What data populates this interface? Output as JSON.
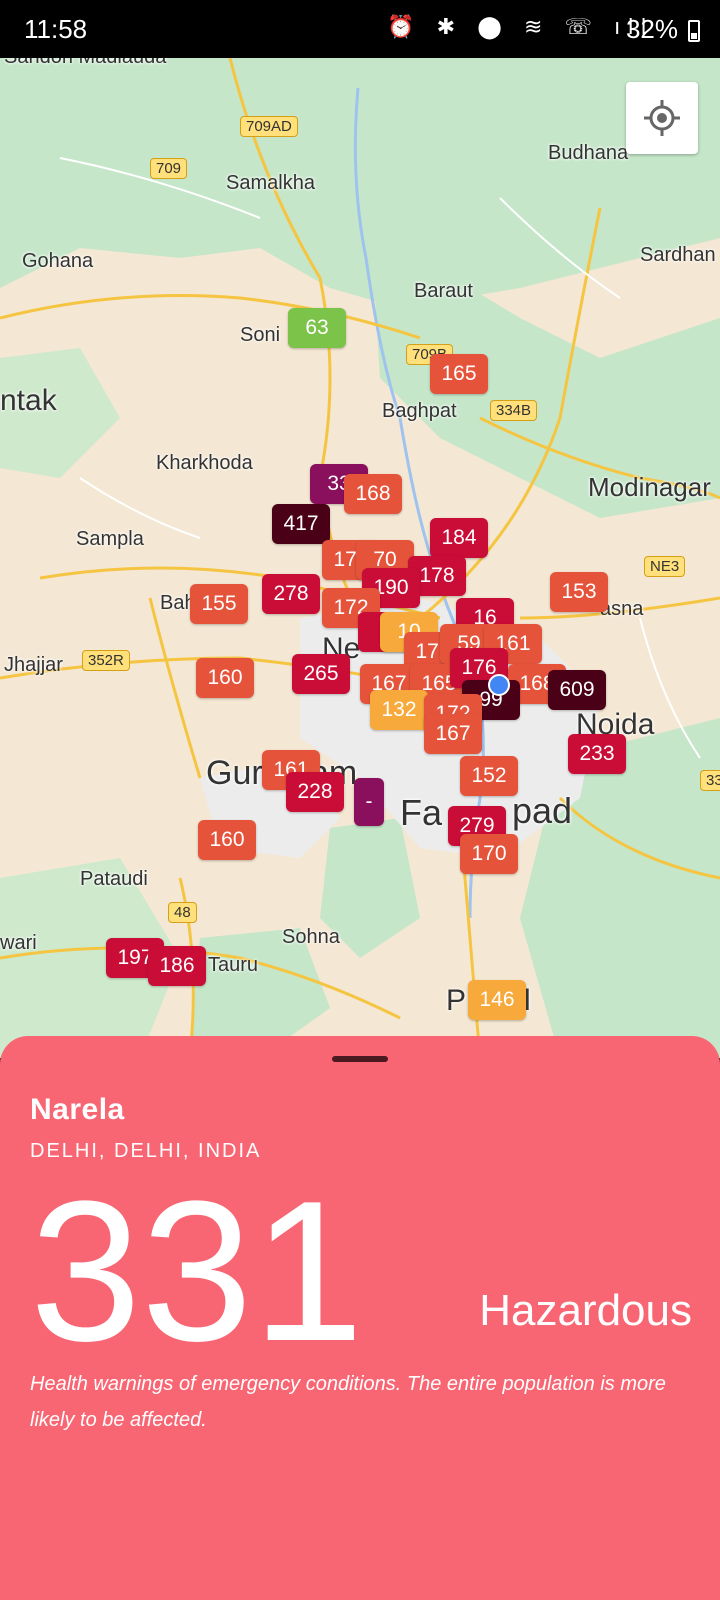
{
  "status_bar": {
    "time": "11:58",
    "icons": "⏰ ✱ ⬤ ≋ ☏ ıll",
    "battery": "32%"
  },
  "map": {
    "place_labels": [
      "Sandoh Madlauda",
      "Samalkha",
      "Budhana",
      "Gohana",
      "Sardhan",
      "Baraut",
      "Soni",
      "Baghpat",
      "ntak",
      "Kharkhoda",
      "Modinagar",
      "Sampla",
      "Bah",
      "g",
      "asna",
      "Jhajjar",
      "Ne",
      "Noida",
      "Gur",
      "am",
      "Fa",
      "pad",
      "Pataudi",
      "Sohna",
      "wari",
      "Tauru",
      "P",
      "l"
    ],
    "road_shields": [
      "709AD",
      "709",
      "709B",
      "334B",
      "352R",
      "NE3",
      "48",
      "33"
    ],
    "markers": [
      {
        "value": "63",
        "color": "#7cc34a"
      },
      {
        "value": "165",
        "color": "#e5533b"
      },
      {
        "value": "33",
        "color": "#8a0f5c"
      },
      {
        "value": "168",
        "color": "#e5533b"
      },
      {
        "value": "417",
        "color": "#4a0017"
      },
      {
        "value": "184",
        "color": "#c90d37"
      },
      {
        "value": "170",
        "color": "#e5533b"
      },
      {
        "value": "70",
        "color": "#e5533b"
      },
      {
        "value": "178",
        "color": "#c90d37"
      },
      {
        "value": "190",
        "color": "#c90d37"
      },
      {
        "value": "278",
        "color": "#c90d37"
      },
      {
        "value": "155",
        "color": "#e5533b"
      },
      {
        "value": "172",
        "color": "#e5533b"
      },
      {
        "value": "153",
        "color": "#e5533b"
      },
      {
        "value": "1",
        "color": "#c90d37"
      },
      {
        "value": "10",
        "color": "#f7a93b"
      },
      {
        "value": "16",
        "color": "#c90d37"
      },
      {
        "value": "172",
        "color": "#e5533b"
      },
      {
        "value": "59",
        "color": "#e5533b"
      },
      {
        "value": "161",
        "color": "#e5533b"
      },
      {
        "value": "160",
        "color": "#e5533b"
      },
      {
        "value": "265",
        "color": "#c90d37"
      },
      {
        "value": "167",
        "color": "#e5533b"
      },
      {
        "value": "165",
        "color": "#e5533b"
      },
      {
        "value": "176",
        "color": "#c90d37"
      },
      {
        "value": "168",
        "color": "#e5533b"
      },
      {
        "value": "99",
        "color": "#4a0017"
      },
      {
        "value": "609",
        "color": "#4a0017"
      },
      {
        "value": "132",
        "color": "#f7a93b"
      },
      {
        "value": "172",
        "color": "#e5533b"
      },
      {
        "value": "167",
        "color": "#e5533b"
      },
      {
        "value": "233",
        "color": "#c90d37"
      },
      {
        "value": "161",
        "color": "#e5533b"
      },
      {
        "value": "228",
        "color": "#c90d37"
      },
      {
        "value": "-",
        "color": "#8a0f5c"
      },
      {
        "value": "152",
        "color": "#e5533b"
      },
      {
        "value": "279",
        "color": "#c90d37"
      },
      {
        "value": "170",
        "color": "#e5533b"
      },
      {
        "value": "160",
        "color": "#e5533b"
      },
      {
        "value": "197",
        "color": "#c90d37"
      },
      {
        "value": "186",
        "color": "#c90d37"
      },
      {
        "value": "146",
        "color": "#f7a93b"
      }
    ]
  },
  "sheet": {
    "station": "Narela",
    "region": "DELHI, DELHI, INDIA",
    "aqi": "331",
    "level": "Hazardous",
    "description": "Health warnings of emergency conditions. The entire population is more likely to be affected.",
    "background": "#f96673"
  }
}
